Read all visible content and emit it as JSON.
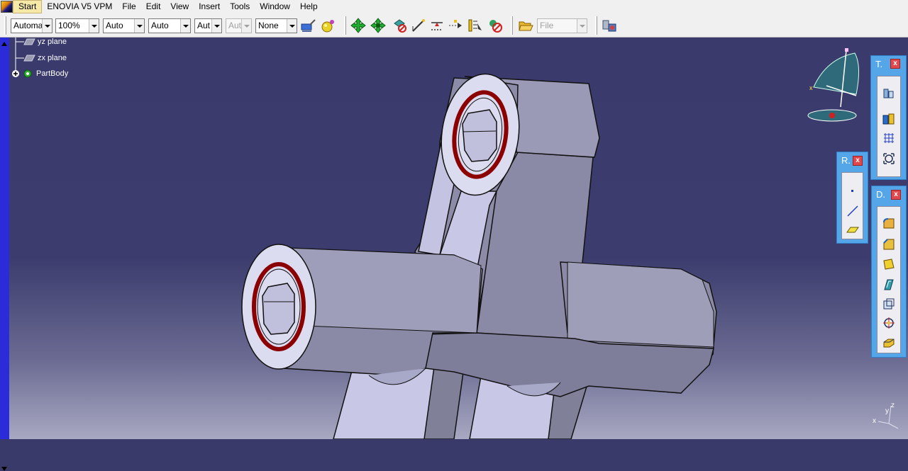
{
  "menubar": {
    "items": [
      {
        "label": "Start"
      },
      {
        "label": "ENOVIA V5 VPM"
      },
      {
        "label": "File"
      },
      {
        "label": "Edit"
      },
      {
        "label": "View"
      },
      {
        "label": "Insert"
      },
      {
        "label": "Tools"
      },
      {
        "label": "Window"
      },
      {
        "label": "Help"
      }
    ]
  },
  "toolbar": {
    "combo_1": "Automa",
    "combo_2": "100%",
    "combo_3": "Auto",
    "combo_4": "Auto",
    "combo_5": "Aut",
    "combo_6": "Aut",
    "combo_7": "None",
    "file_combo": "File"
  },
  "tree": {
    "items": [
      {
        "label": "yz plane"
      },
      {
        "label": "zx plane"
      },
      {
        "label": "PartBody"
      }
    ]
  },
  "panels": {
    "t": {
      "title": "T.",
      "close": "x"
    },
    "r": {
      "title": "R.",
      "close": "x"
    },
    "d": {
      "title": "D.",
      "close": "x"
    }
  },
  "axes": {
    "x": "x",
    "y": "y",
    "z": "z"
  },
  "colors": {
    "viewport_top": "#3a3a6c",
    "viewport_bottom": "#a8a8c2",
    "panel_blue": "#55a6e9",
    "selection_bar": "#2b2bd9",
    "part_face": "#8a8aaa",
    "highlight_ring": "#8b0000"
  }
}
